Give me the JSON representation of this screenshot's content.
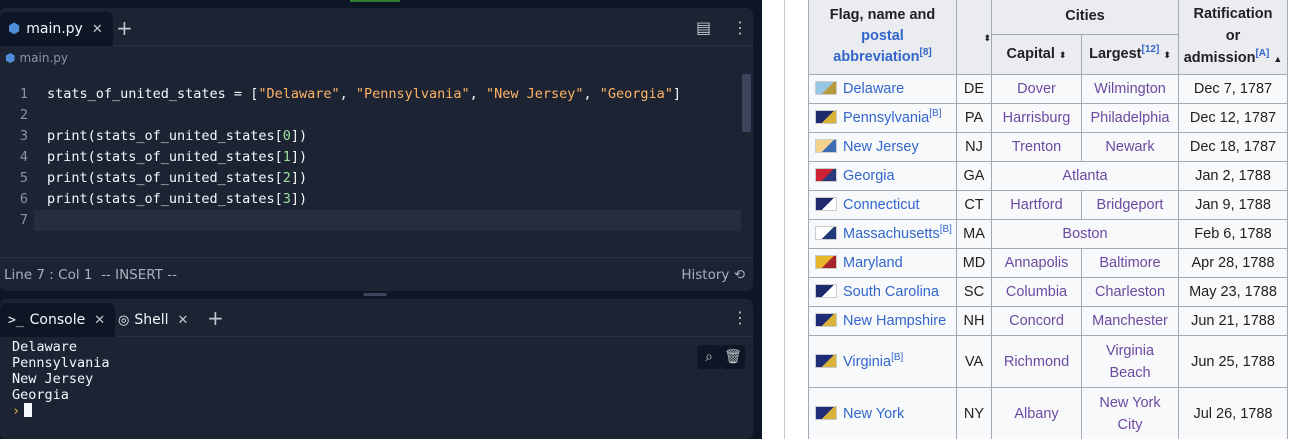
{
  "editor": {
    "tab": {
      "label": "main.py"
    },
    "breadcrumb": "main.py",
    "lines": [
      {
        "n": "1",
        "t": "stats_of_united_states = [\"Delaware\", \"Pennsylvania\", \"New Jersey\", \"Georgia\"]"
      },
      {
        "n": "2",
        "t": ""
      },
      {
        "n": "3",
        "t": "print(stats_of_united_states[0])"
      },
      {
        "n": "4",
        "t": "print(stats_of_united_states[1])"
      },
      {
        "n": "5",
        "t": "print(stats_of_united_states[2])"
      },
      {
        "n": "6",
        "t": "print(stats_of_united_states[3])"
      },
      {
        "n": "7",
        "t": ""
      }
    ],
    "status": {
      "position": "Line 7 : Col 1",
      "mode": "-- INSERT --",
      "history": "History"
    }
  },
  "console": {
    "tabs": [
      {
        "label": "Console",
        "icon": "terminal-icon"
      },
      {
        "label": "Shell",
        "icon": "shell-icon"
      }
    ],
    "output": [
      "Delaware",
      "Pennsylvania",
      "New Jersey",
      "Georgia"
    ],
    "prompt": "›"
  },
  "table": {
    "headers": {
      "flag_name": "Flag, name and",
      "postal": "postal abbreviation",
      "postal_ref": "[8]",
      "cities": "Cities",
      "capital": "Capital",
      "largest": "Largest",
      "largest_ref": "[12]",
      "ratification_1": "Ratification",
      "ratification_2": "or",
      "ratification_3": "admission",
      "ratification_ref": "[A]"
    },
    "rows": [
      {
        "name": "Delaware",
        "ref": "",
        "abbr": "DE",
        "capital": "Dover",
        "largest": "Wilmington",
        "date": "Dec 7, 1787",
        "colors": [
          "#98c6e5",
          "#b89a3e"
        ]
      },
      {
        "name": "Pennsylvania",
        "ref": "[B]",
        "abbr": "PA",
        "capital": "Harrisburg",
        "largest": "Philadelphia",
        "date": "Dec 12, 1787",
        "colors": [
          "#1d2a6b",
          "#d9b23a"
        ]
      },
      {
        "name": "New Jersey",
        "ref": "",
        "abbr": "NJ",
        "capital": "Trenton",
        "largest": "Newark",
        "date": "Dec 18, 1787",
        "colors": [
          "#f2d28c",
          "#3d6cb5"
        ]
      },
      {
        "name": "Georgia",
        "ref": "",
        "abbr": "GA",
        "capital": "Atlanta",
        "largest": "",
        "merged": true,
        "date": "Jan 2, 1788",
        "colors": [
          "#cc2233",
          "#2a3a7b"
        ]
      },
      {
        "name": "Connecticut",
        "ref": "",
        "abbr": "CT",
        "capital": "Hartford",
        "largest": "Bridgeport",
        "date": "Jan 9, 1788",
        "colors": [
          "#1f2b6e",
          "#ffffff"
        ]
      },
      {
        "name": "Massachusetts",
        "ref": "[B]",
        "abbr": "MA",
        "capital": "Boston",
        "largest": "",
        "merged": true,
        "date": "Feb 6, 1788",
        "colors": [
          "#ffffff",
          "#1f3a7a"
        ]
      },
      {
        "name": "Maryland",
        "ref": "",
        "abbr": "MD",
        "capital": "Annapolis",
        "largest": "Baltimore",
        "date": "Apr 28, 1788",
        "colors": [
          "#e8b62a",
          "#a8242b"
        ]
      },
      {
        "name": "South Carolina",
        "ref": "",
        "abbr": "SC",
        "capital": "Columbia",
        "largest": "Charleston",
        "date": "May 23, 1788",
        "colors": [
          "#1b2b6e",
          "#ffffff"
        ]
      },
      {
        "name": "New Hampshire",
        "ref": "",
        "abbr": "NH",
        "capital": "Concord",
        "largest": "Manchester",
        "date": "Jun 21, 1788",
        "colors": [
          "#1f2d78",
          "#d9b23a"
        ]
      },
      {
        "name": "Virginia",
        "ref": "[B]",
        "abbr": "VA",
        "capital": "Richmond",
        "largest": "Virginia Beach",
        "largest_lines": [
          "Virginia",
          "Beach"
        ],
        "date": "Jun 25, 1788",
        "colors": [
          "#1f2d78",
          "#d9b23a"
        ]
      },
      {
        "name": "New York",
        "ref": "",
        "abbr": "NY",
        "capital": "Albany",
        "largest": "New York City",
        "largest_lines": [
          "New York",
          "City"
        ],
        "date": "Jul 26, 1788",
        "colors": [
          "#1f2d78",
          "#d9b23a"
        ]
      }
    ]
  }
}
